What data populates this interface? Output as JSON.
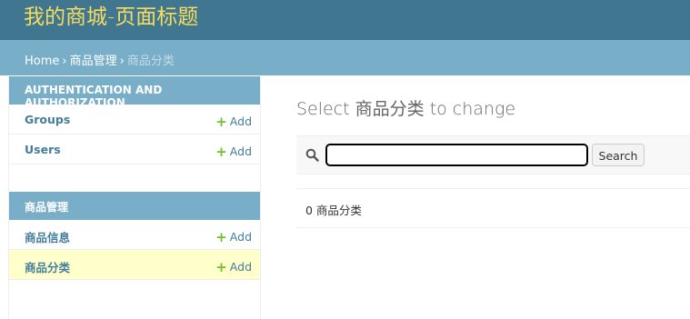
{
  "header": {
    "brand": "我的商城-页面标题"
  },
  "breadcrumbs": {
    "home": "Home",
    "separator": "›",
    "app": "商品管理",
    "current": "商品分类"
  },
  "sidebar": {
    "modules": [
      {
        "caption": "AUTHENTICATION AND AUTHORIZATION",
        "models": [
          {
            "name": "Groups",
            "add_label": "Add"
          },
          {
            "name": "Users",
            "add_label": "Add"
          }
        ]
      },
      {
        "caption": "商品管理",
        "models": [
          {
            "name": "商品信息",
            "add_label": "Add"
          },
          {
            "name": "商品分类",
            "add_label": "Add",
            "selected": true
          }
        ]
      }
    ]
  },
  "main": {
    "title": "Select 商品分类 to change",
    "search": {
      "value": "",
      "button_label": "Search"
    },
    "result_count": "0 商品分类"
  },
  "colors": {
    "header_bg": "#417690",
    "brand_text": "#f5dd5d",
    "breadcrumb_bg": "#79aec8",
    "link": "#447e9b",
    "add_icon": "#70bf2b",
    "selected_row": "#ffffcc"
  }
}
